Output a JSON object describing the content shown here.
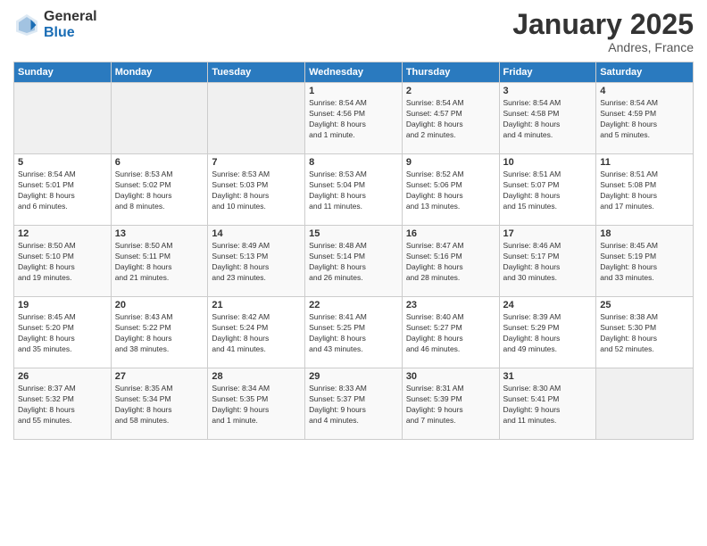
{
  "header": {
    "logo_general": "General",
    "logo_blue": "Blue",
    "month_title": "January 2025",
    "location": "Andres, France"
  },
  "days_of_week": [
    "Sunday",
    "Monday",
    "Tuesday",
    "Wednesday",
    "Thursday",
    "Friday",
    "Saturday"
  ],
  "weeks": [
    [
      {
        "day": "",
        "text": ""
      },
      {
        "day": "",
        "text": ""
      },
      {
        "day": "",
        "text": ""
      },
      {
        "day": "1",
        "text": "Sunrise: 8:54 AM\nSunset: 4:56 PM\nDaylight: 8 hours\nand 1 minute."
      },
      {
        "day": "2",
        "text": "Sunrise: 8:54 AM\nSunset: 4:57 PM\nDaylight: 8 hours\nand 2 minutes."
      },
      {
        "day": "3",
        "text": "Sunrise: 8:54 AM\nSunset: 4:58 PM\nDaylight: 8 hours\nand 4 minutes."
      },
      {
        "day": "4",
        "text": "Sunrise: 8:54 AM\nSunset: 4:59 PM\nDaylight: 8 hours\nand 5 minutes."
      }
    ],
    [
      {
        "day": "5",
        "text": "Sunrise: 8:54 AM\nSunset: 5:01 PM\nDaylight: 8 hours\nand 6 minutes."
      },
      {
        "day": "6",
        "text": "Sunrise: 8:53 AM\nSunset: 5:02 PM\nDaylight: 8 hours\nand 8 minutes."
      },
      {
        "day": "7",
        "text": "Sunrise: 8:53 AM\nSunset: 5:03 PM\nDaylight: 8 hours\nand 10 minutes."
      },
      {
        "day": "8",
        "text": "Sunrise: 8:53 AM\nSunset: 5:04 PM\nDaylight: 8 hours\nand 11 minutes."
      },
      {
        "day": "9",
        "text": "Sunrise: 8:52 AM\nSunset: 5:06 PM\nDaylight: 8 hours\nand 13 minutes."
      },
      {
        "day": "10",
        "text": "Sunrise: 8:51 AM\nSunset: 5:07 PM\nDaylight: 8 hours\nand 15 minutes."
      },
      {
        "day": "11",
        "text": "Sunrise: 8:51 AM\nSunset: 5:08 PM\nDaylight: 8 hours\nand 17 minutes."
      }
    ],
    [
      {
        "day": "12",
        "text": "Sunrise: 8:50 AM\nSunset: 5:10 PM\nDaylight: 8 hours\nand 19 minutes."
      },
      {
        "day": "13",
        "text": "Sunrise: 8:50 AM\nSunset: 5:11 PM\nDaylight: 8 hours\nand 21 minutes."
      },
      {
        "day": "14",
        "text": "Sunrise: 8:49 AM\nSunset: 5:13 PM\nDaylight: 8 hours\nand 23 minutes."
      },
      {
        "day": "15",
        "text": "Sunrise: 8:48 AM\nSunset: 5:14 PM\nDaylight: 8 hours\nand 26 minutes."
      },
      {
        "day": "16",
        "text": "Sunrise: 8:47 AM\nSunset: 5:16 PM\nDaylight: 8 hours\nand 28 minutes."
      },
      {
        "day": "17",
        "text": "Sunrise: 8:46 AM\nSunset: 5:17 PM\nDaylight: 8 hours\nand 30 minutes."
      },
      {
        "day": "18",
        "text": "Sunrise: 8:45 AM\nSunset: 5:19 PM\nDaylight: 8 hours\nand 33 minutes."
      }
    ],
    [
      {
        "day": "19",
        "text": "Sunrise: 8:45 AM\nSunset: 5:20 PM\nDaylight: 8 hours\nand 35 minutes."
      },
      {
        "day": "20",
        "text": "Sunrise: 8:43 AM\nSunset: 5:22 PM\nDaylight: 8 hours\nand 38 minutes."
      },
      {
        "day": "21",
        "text": "Sunrise: 8:42 AM\nSunset: 5:24 PM\nDaylight: 8 hours\nand 41 minutes."
      },
      {
        "day": "22",
        "text": "Sunrise: 8:41 AM\nSunset: 5:25 PM\nDaylight: 8 hours\nand 43 minutes."
      },
      {
        "day": "23",
        "text": "Sunrise: 8:40 AM\nSunset: 5:27 PM\nDaylight: 8 hours\nand 46 minutes."
      },
      {
        "day": "24",
        "text": "Sunrise: 8:39 AM\nSunset: 5:29 PM\nDaylight: 8 hours\nand 49 minutes."
      },
      {
        "day": "25",
        "text": "Sunrise: 8:38 AM\nSunset: 5:30 PM\nDaylight: 8 hours\nand 52 minutes."
      }
    ],
    [
      {
        "day": "26",
        "text": "Sunrise: 8:37 AM\nSunset: 5:32 PM\nDaylight: 8 hours\nand 55 minutes."
      },
      {
        "day": "27",
        "text": "Sunrise: 8:35 AM\nSunset: 5:34 PM\nDaylight: 8 hours\nand 58 minutes."
      },
      {
        "day": "28",
        "text": "Sunrise: 8:34 AM\nSunset: 5:35 PM\nDaylight: 9 hours\nand 1 minute."
      },
      {
        "day": "29",
        "text": "Sunrise: 8:33 AM\nSunset: 5:37 PM\nDaylight: 9 hours\nand 4 minutes."
      },
      {
        "day": "30",
        "text": "Sunrise: 8:31 AM\nSunset: 5:39 PM\nDaylight: 9 hours\nand 7 minutes."
      },
      {
        "day": "31",
        "text": "Sunrise: 8:30 AM\nSunset: 5:41 PM\nDaylight: 9 hours\nand 11 minutes."
      },
      {
        "day": "",
        "text": ""
      }
    ]
  ]
}
